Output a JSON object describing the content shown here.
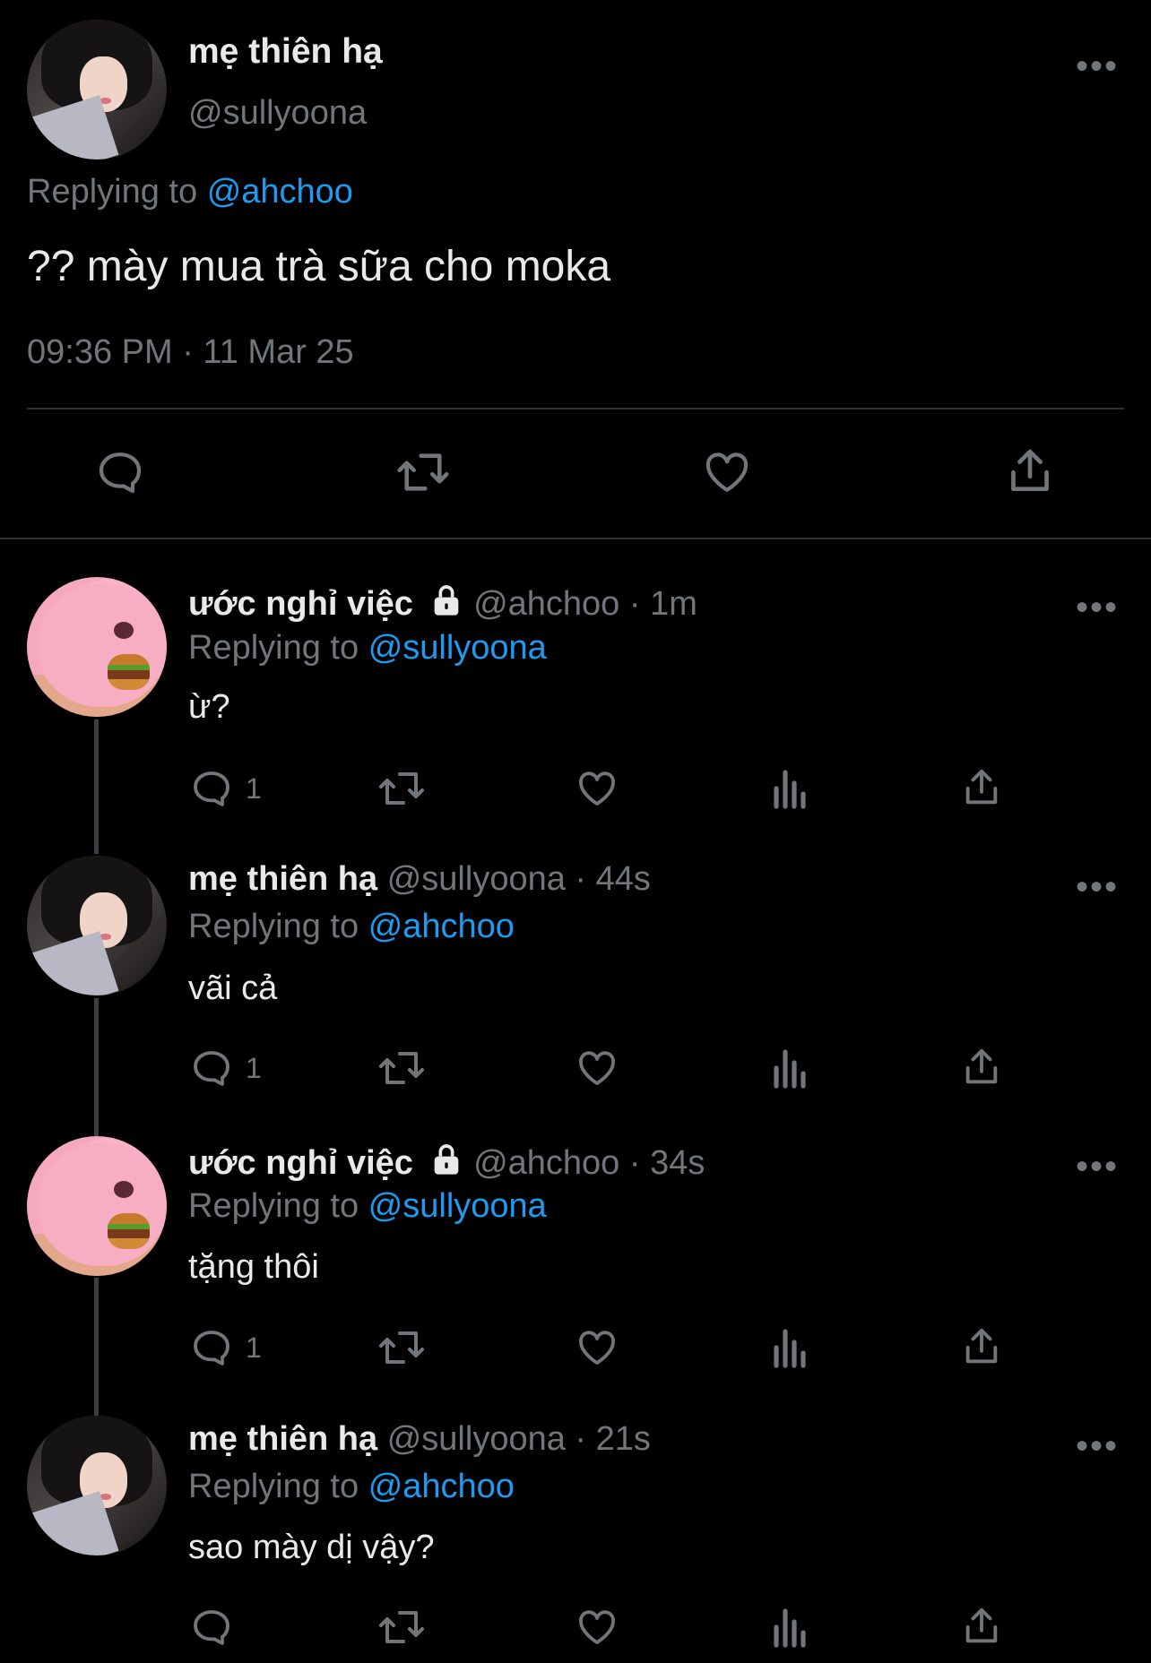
{
  "main_tweet": {
    "display_name": "mẹ thiên hạ",
    "handle": "@sullyoona",
    "replying_prefix": "Replying to",
    "replying_to": "@ahchoo",
    "text": "?? mày mua trà sữa cho moka",
    "timestamp": "09:36 PM · 11 Mar 25",
    "more": "•••",
    "actions": [
      "reply-icon",
      "retweet-icon",
      "like-icon",
      "share-icon"
    ]
  },
  "replies": [
    {
      "display_name": "ước nghỉ việc",
      "protected": true,
      "handle": "@ahchoo",
      "time": "· 1m",
      "replying_prefix": "Replying to",
      "replying_to": "@sullyoona",
      "text": "ừ?",
      "reply_count": "1",
      "more": "•••"
    },
    {
      "display_name": "mẹ thiên hạ",
      "protected": false,
      "handle": "@sullyoona",
      "time": "· 44s",
      "replying_prefix": "Replying to",
      "replying_to": "@ahchoo",
      "text": "vãi cả",
      "reply_count": "1",
      "more": "•••"
    },
    {
      "display_name": "ước nghỉ việc",
      "protected": true,
      "handle": "@ahchoo",
      "time": "· 34s",
      "replying_prefix": "Replying to",
      "replying_to": "@sullyoona",
      "text": "tặng thôi",
      "reply_count": "1",
      "more": "•••"
    },
    {
      "display_name": "mẹ thiên hạ",
      "protected": false,
      "handle": "@sullyoona",
      "time": "· 21s",
      "replying_prefix": "Replying to",
      "replying_to": "@ahchoo",
      "text": "sao mày dị vậy?",
      "reply_count": "",
      "more": "•••"
    }
  ],
  "colors": {
    "background": "#000000",
    "text": "#e7e9ea",
    "muted": "#71767b",
    "link": "#1d9bf0",
    "divider": "#2f3336"
  }
}
